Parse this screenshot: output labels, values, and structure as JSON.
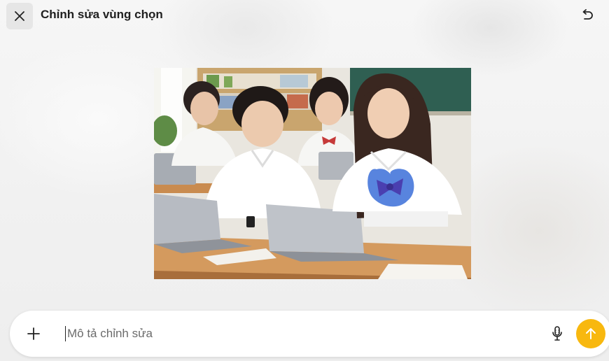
{
  "header": {
    "title": "Chỉnh sửa vùng chọn",
    "close_icon": "close-icon",
    "undo_icon": "undo-icon"
  },
  "image": {
    "subject": "students-with-laptops-photo",
    "selection_color": "#3b6fd8"
  },
  "composer": {
    "placeholder": "Mô tả chỉnh sửa",
    "value": "",
    "add_icon": "plus-icon",
    "mic_icon": "microphone-icon",
    "send_icon": "arrow-up-icon",
    "send_color": "#f8b80f"
  }
}
